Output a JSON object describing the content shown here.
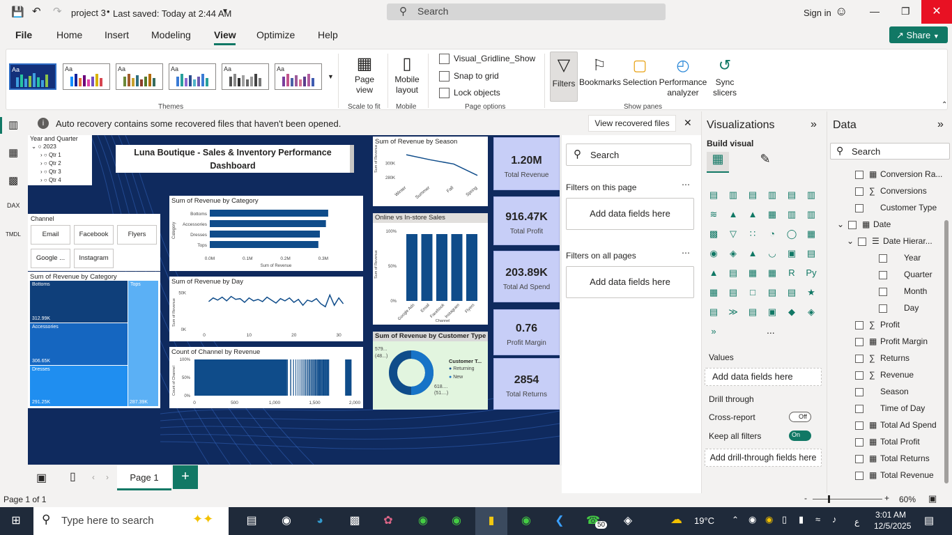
{
  "titlebar": {
    "project": "project 3",
    "saved": "Last saved: Today at 2:44 AM",
    "search": "Search",
    "signin": "Sign in"
  },
  "menu": {
    "items": [
      "File",
      "Home",
      "Insert",
      "Modeling",
      "View",
      "Optimize",
      "Help"
    ],
    "share": "Share"
  },
  "ribbon": {
    "themes_label": "Themes",
    "page_view": "Page view",
    "scale_label": "Scale to fit",
    "mobile_layout": "Mobile layout",
    "mobile_label": "Mobile",
    "gridline": "Visual_Gridline_Show",
    "snap": "Snap to grid",
    "lock": "Lock objects",
    "page_options": "Page options",
    "filters": "Filters",
    "bookmarks": "Bookmarks",
    "selection": "Selection",
    "performance": "Performance analyzer",
    "sync": "Sync slicers",
    "show_panes": "Show panes"
  },
  "notice": {
    "text": "Auto recovery contains some recovered files that haven't been opened.",
    "button": "View recovered files"
  },
  "report": {
    "title": "Luna Boutique - Sales & Inventory Performance Dashboard",
    "slicer_year": {
      "title": "Year and Quarter",
      "year": "2023",
      "quarters": [
        "Qtr 1",
        "Qtr 2",
        "Qtr 3",
        "Qtr 4"
      ]
    },
    "slicer_channel": {
      "title": "Channel",
      "items": [
        "Email",
        "Facebook",
        "Flyers",
        "Google ...",
        "Instagram"
      ]
    },
    "treemap": {
      "title": "Sum of Revenue by Category",
      "cells": [
        {
          "name": "Bottoms",
          "value": "312.99K"
        },
        {
          "name": "Accessories",
          "value": "306.65K"
        },
        {
          "name": "Dresses",
          "value": "291.25K"
        },
        {
          "name": "Tops",
          "value": "287.39K"
        }
      ]
    },
    "kpis": [
      {
        "value": "1.20M",
        "label": "Total Revenue"
      },
      {
        "value": "916.47K",
        "label": "Total Profit"
      },
      {
        "value": "203.89K",
        "label": "Total Ad Spend"
      },
      {
        "value": "0.76",
        "label": "Profit Margin"
      },
      {
        "value": "2854",
        "label": "Total Returns"
      }
    ],
    "donut": {
      "title": "Sum of Revenue by Customer Type",
      "legend_title": "Customer T...",
      "legend": [
        "Returning",
        "New"
      ],
      "label_a": "579...",
      "label_a2": "(48...)",
      "label_b": "618....",
      "label_b2": "(51....)"
    }
  },
  "chart_data": [
    {
      "type": "bar",
      "title": "Sum of Revenue by Category",
      "xlabel": "Sum of Revenue",
      "ylabel": "Category",
      "categories": [
        "Bottoms",
        "Accessories",
        "Dresses",
        "Tops"
      ],
      "values": [
        313,
        307,
        291,
        287
      ],
      "xticks": [
        "0.0M",
        "0.1M",
        "0.2M",
        "0.3M"
      ],
      "xlim": [
        0,
        350
      ]
    },
    {
      "type": "line",
      "title": "Sum of Revenue by Season",
      "ylabel": "Sum of Revenue",
      "categories": [
        "Winter",
        "Summer",
        "Fall",
        "Spring"
      ],
      "values": [
        312,
        305,
        299,
        283
      ],
      "yticks": [
        "300K",
        "280K"
      ],
      "ylim": [
        275,
        318
      ]
    },
    {
      "type": "line",
      "title": "Sum of Revenue by Day",
      "ylabel": "Sum of Revenue",
      "x": [
        1,
        2,
        3,
        4,
        5,
        6,
        7,
        8,
        9,
        10,
        11,
        12,
        13,
        14,
        15,
        16,
        17,
        18,
        19,
        20,
        21,
        22,
        23,
        24,
        25,
        26,
        27,
        28,
        29,
        30,
        31
      ],
      "values": [
        38,
        43,
        40,
        44,
        39,
        45,
        41,
        42,
        37,
        43,
        39,
        41,
        38,
        44,
        40,
        36,
        42,
        39,
        43,
        37,
        41,
        33,
        40,
        38,
        42,
        35,
        31,
        47,
        33,
        43,
        35
      ],
      "xticks": [
        "0",
        "10",
        "20",
        "30"
      ],
      "yticks": [
        "50K",
        "0K"
      ],
      "ylim": [
        0,
        55
      ]
    },
    {
      "type": "bar",
      "title": "Online vs In-store Sales",
      "xlabel": "Channel",
      "ylabel": "Sum of Revenue",
      "categories": [
        "Google Ads",
        "Email",
        "Facebook",
        "Instagram",
        "Flyers"
      ],
      "values": [
        96,
        96,
        96,
        96,
        96
      ],
      "yticks": [
        "100%",
        "50%",
        "0%"
      ],
      "ylim": [
        0,
        100
      ]
    },
    {
      "type": "bar",
      "title": "Count of Channel by Revenue",
      "ylabel": "Count of Channel",
      "xticks": [
        "0",
        "500",
        "1,000",
        "1,500",
        "2,000"
      ],
      "yticks": [
        "100%",
        "50%",
        "0%"
      ],
      "xlim": [
        0,
        2000
      ]
    }
  ],
  "filters": {
    "search": "Search",
    "on_page": "Filters on this page",
    "on_all": "Filters on all pages",
    "add": "Add data fields here"
  },
  "viz": {
    "title": "Visualizations",
    "build": "Build visual",
    "values": "Values",
    "add": "Add data fields here",
    "drill": "Drill through",
    "cross": "Cross-report",
    "cross_state": "Off",
    "keep": "Keep all filters",
    "keep_state": "On",
    "drill_add": "Add drill-through fields here",
    "more": "..."
  },
  "data": {
    "title": "Data",
    "search": "Search",
    "fields": [
      "Conversion Ra...",
      "Conversions",
      "Customer Type",
      "Date",
      "Date Hierar...",
      "Year",
      "Quarter",
      "Month",
      "Day",
      "Profit",
      "Profit Margin",
      "Returns",
      "Revenue",
      "Season",
      "Time of Day",
      "Total Ad Spend",
      "Total Profit",
      "Total Returns",
      "Total Revenue"
    ]
  },
  "pages": {
    "tab": "Page 1",
    "status": "Page 1 of 1",
    "zoom": "60%"
  },
  "taskbar": {
    "search": "Type here to search",
    "temp": "19°C",
    "time": "3:01 AM",
    "date": "12/5/2025",
    "badge": "50",
    "lang": "ع"
  },
  "colors": {
    "accent": "#117865",
    "report_bg": "#0f2a5e",
    "bar": "#0f4c8a",
    "kpi": "#c7cef7",
    "close": "#e81123"
  }
}
